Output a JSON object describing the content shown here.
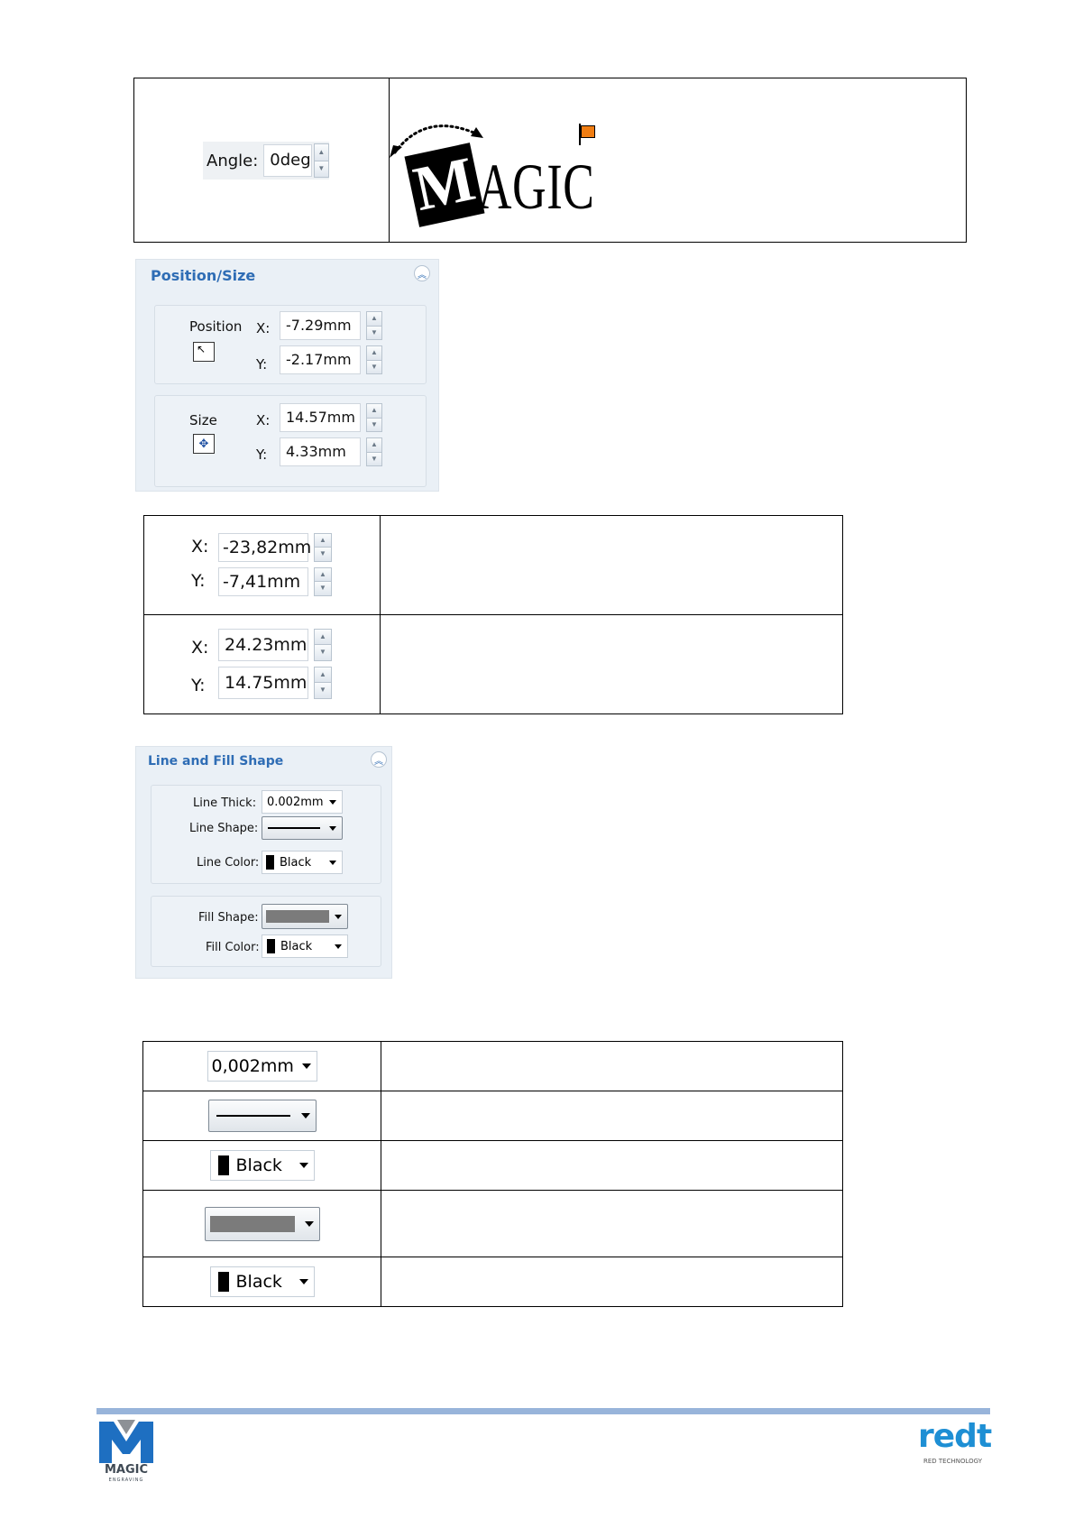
{
  "angle_row": {
    "label": "Angle:",
    "value": "0deg",
    "logo_text": "MAGIC",
    "logo_first_letter": "M",
    "logo_rest": "AGIC"
  },
  "position_size": {
    "title": "Position/Size",
    "position_label": "Position",
    "size_label": "Size",
    "x_label": "X:",
    "y_label": "Y:",
    "pos_x": "-7.29mm",
    "pos_y": "-2.17mm",
    "size_x": "14.57mm",
    "size_y": "4.33mm"
  },
  "xy_table": [
    {
      "x_label": "X:",
      "x": "-23,82mm",
      "y_label": "Y:",
      "y": "-7,41mm",
      "description": ""
    },
    {
      "x_label": "X:",
      "x": "24.23mm",
      "y_label": "Y:",
      "y": "14.75mm",
      "description": ""
    }
  ],
  "line_fill": {
    "title": "Line and Fill Shape",
    "line_thick_label": "Line Thick:",
    "line_thick": "0.002mm",
    "line_shape_label": "Line Shape:",
    "line_color_label": "Line Color:",
    "line_color": "Black",
    "fill_shape_label": "Fill Shape:",
    "fill_color_label": "Fill Color:",
    "fill_color": "Black"
  },
  "options_table": [
    {
      "value": "0,002mm",
      "description": ""
    },
    {
      "value": "",
      "description": ""
    },
    {
      "value": "Black",
      "description": ""
    },
    {
      "value": "",
      "description": ""
    },
    {
      "value": "Black",
      "description": ""
    }
  ],
  "footer": {
    "left_logo_letter": "M",
    "left_logo_name": "MAGIC",
    "left_logo_sub": "ENGRAVING",
    "right_logo_name": "redt",
    "right_logo_sub": "RED TECHNOLOGY"
  },
  "colors": {
    "panel_title": "#2f6db5",
    "footer_line": "#98b4da",
    "flag": "#f07d12",
    "brand_blue": "#1e6fc1"
  }
}
